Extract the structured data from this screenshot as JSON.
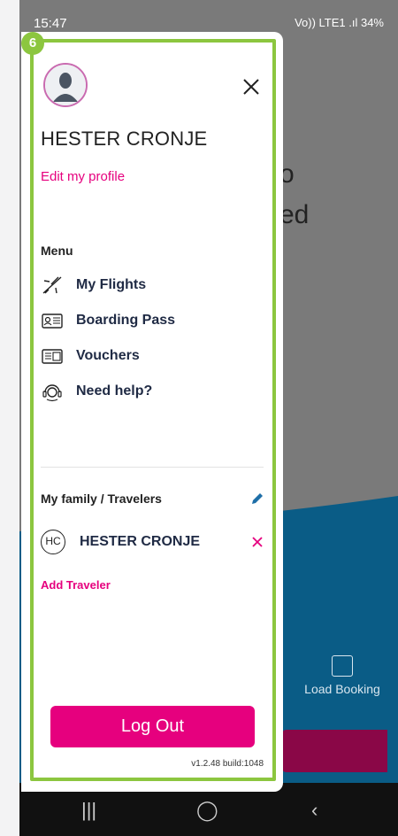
{
  "status_bar": {
    "time": "15:47",
    "indicators": "Vo)) LTE1 .ıl 34%"
  },
  "background": {
    "partial_text_1": "o",
    "partial_text_2": "ed",
    "load_booking_label": "Load Booking"
  },
  "overlay": {
    "step_badge": "6"
  },
  "drawer": {
    "user_name": "HESTER CRONJE",
    "edit_profile_label": "Edit my profile",
    "menu_title": "Menu",
    "menu_items": [
      {
        "label": "My Flights",
        "icon": "airplane-icon"
      },
      {
        "label": "Boarding Pass",
        "icon": "boarding-pass-icon"
      },
      {
        "label": "Vouchers",
        "icon": "voucher-icon"
      },
      {
        "label": "Need help?",
        "icon": "headset-icon"
      }
    ],
    "family_title": "My family / Travelers",
    "travelers": [
      {
        "initials": "HC",
        "name": "HESTER CRONJE"
      }
    ],
    "add_traveler_label": "Add Traveler",
    "logout_label": "Log Out",
    "version": "v1.2.48 build:1048"
  },
  "colors": {
    "accent": "#e6007e",
    "highlight_frame": "#8cc63f",
    "navy_text": "#1f2a44",
    "wave": "#0a5c86"
  }
}
